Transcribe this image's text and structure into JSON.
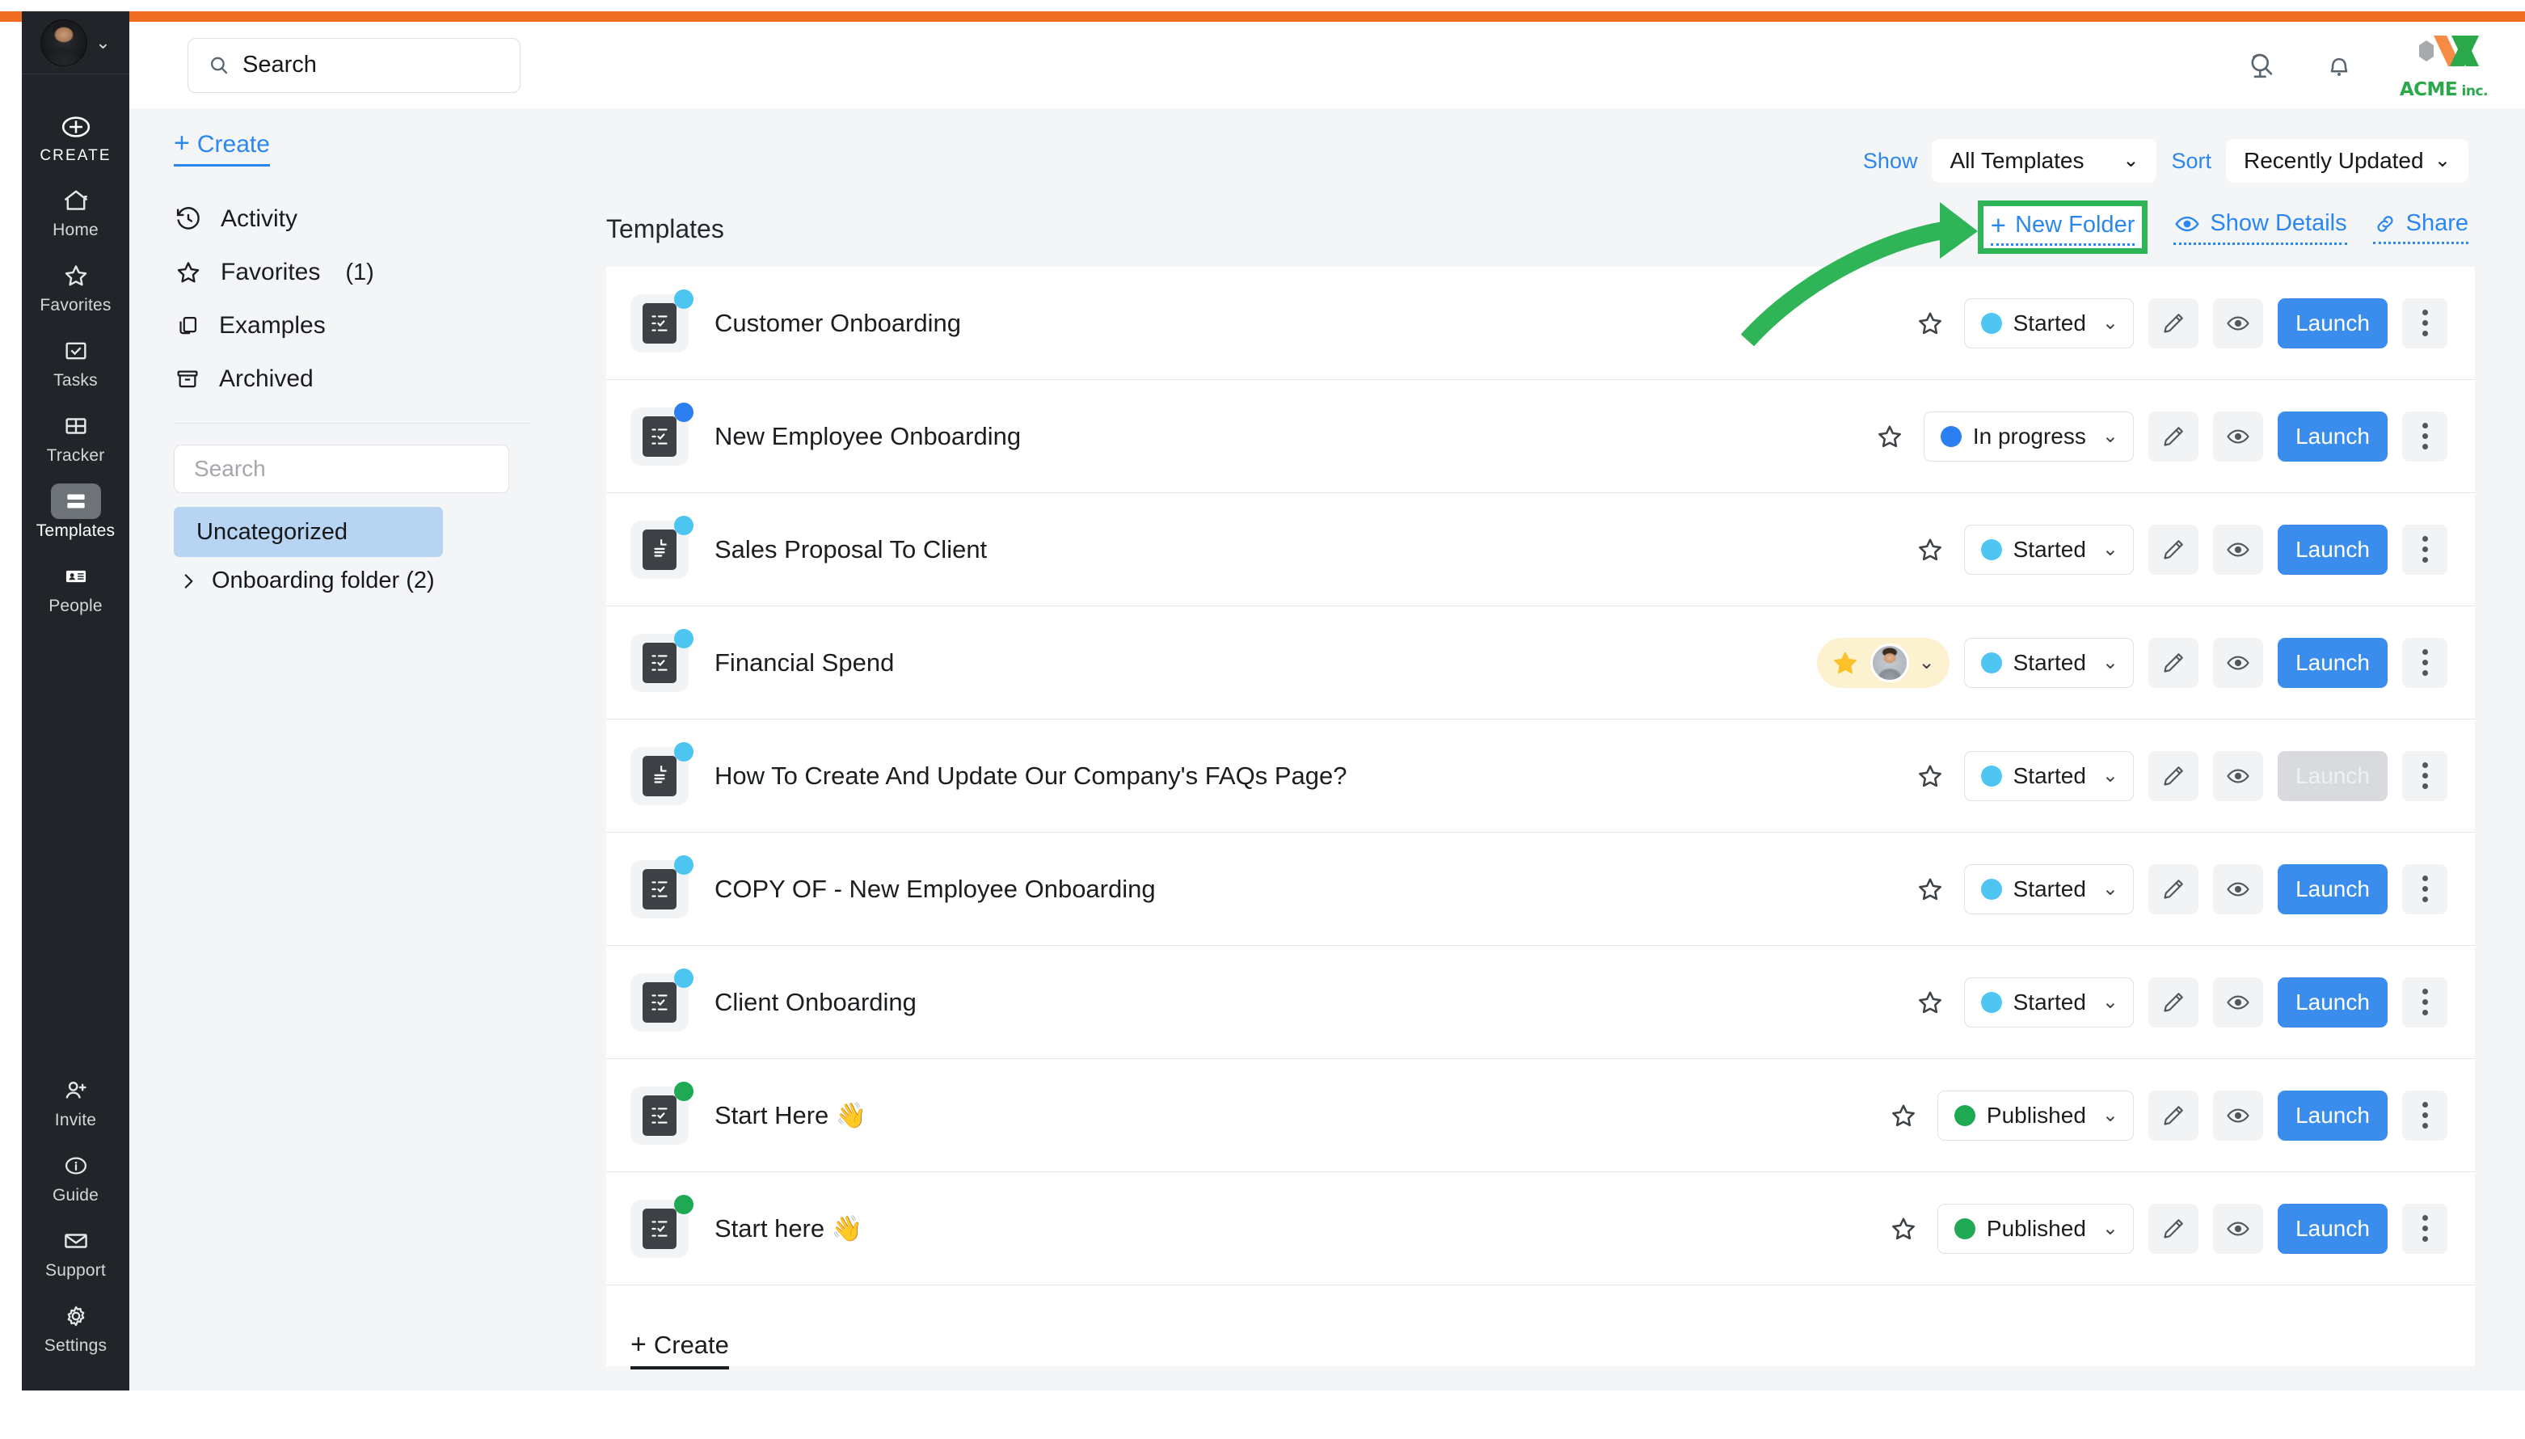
{
  "theme": {
    "accent_orange": "#ef6c23",
    "accent_blue": "#2b87f0",
    "launch_blue": "#3b8ded",
    "highlight_green": "#2fb457",
    "status_started": "#4ec5f1",
    "status_in_progress": "#2b7ff0",
    "status_published": "#1fa952",
    "favorite_yellow": "#fdf2cf",
    "star_gold": "#fcc12a"
  },
  "rail": {
    "profile": {
      "avatar": "user-avatar",
      "chevron": "chevron-down-icon"
    },
    "items": [
      {
        "label": "CREATE",
        "icon": "plus-circle-icon",
        "active": false
      },
      {
        "label": "Home",
        "icon": "home-icon",
        "active": false
      },
      {
        "label": "Favorites",
        "icon": "star-icon",
        "active": false
      },
      {
        "label": "Tasks",
        "icon": "check-square-icon",
        "active": false
      },
      {
        "label": "Tracker",
        "icon": "grid-icon",
        "active": false
      },
      {
        "label": "Templates",
        "icon": "templates-icon",
        "active": true
      },
      {
        "label": "People",
        "icon": "contact-card-icon",
        "active": false
      }
    ],
    "bottom_items": [
      {
        "label": "Invite",
        "icon": "user-plus-icon"
      },
      {
        "label": "Guide",
        "icon": "info-circle-icon"
      },
      {
        "label": "Support",
        "icon": "envelope-icon"
      },
      {
        "label": "Settings",
        "icon": "gear-icon"
      }
    ]
  },
  "header": {
    "search": {
      "placeholder": "Search",
      "value": "Search",
      "icon": "search-icon"
    },
    "globe_icon": "globe-icon",
    "bell_icon": "bell-icon",
    "brand": {
      "name": "ACME",
      "suffix": " inc.",
      "logo": "acme-hexagon-logo"
    }
  },
  "leftnav": {
    "create_label": "Create",
    "create_plus": "+",
    "items": [
      {
        "label": "Activity",
        "icon": "history-icon",
        "count": ""
      },
      {
        "label": "Favorites",
        "icon": "star-icon",
        "count": "(1)"
      },
      {
        "label": "Examples",
        "icon": "copy-icon",
        "count": ""
      },
      {
        "label": "Archived",
        "icon": "archive-icon",
        "count": ""
      }
    ],
    "folder_search_placeholder": "Search",
    "folders": [
      {
        "label": "Uncategorized",
        "selected": true,
        "expandable": false
      },
      {
        "label": "Onboarding folder (2)",
        "selected": false,
        "expandable": true
      }
    ]
  },
  "toolbar": {
    "show_label": "Show",
    "show_value": "All Templates",
    "sort_label": "Sort",
    "sort_value": "Recently Updated",
    "new_folder_label": "New Folder",
    "new_folder_plus": "+",
    "show_details_label": "Show Details",
    "share_label": "Share",
    "eye_icon": "eye-icon",
    "link_icon": "link-icon",
    "highlighted_action": "New Folder"
  },
  "main": {
    "title": "Templates",
    "create_bottom_label": "Create",
    "create_bottom_plus": "+",
    "launch_label": "Launch",
    "rows": [
      {
        "title": "Customer Onboarding",
        "icon": "checklist-tile-icon",
        "badge_color": "#4ec5f1",
        "status": "Started",
        "status_color": "#4ec5f1",
        "favorited": false,
        "launch_enabled": true
      },
      {
        "title": "New Employee Onboarding",
        "icon": "checklist-tile-icon",
        "badge_color": "#2b7ff0",
        "status": "In progress",
        "status_color": "#2b7ff0",
        "favorited": false,
        "launch_enabled": true
      },
      {
        "title": "Sales Proposal To Client",
        "icon": "document-tile-icon",
        "badge_color": "#4ec5f1",
        "status": "Started",
        "status_color": "#4ec5f1",
        "favorited": false,
        "launch_enabled": true
      },
      {
        "title": "Financial Spend",
        "icon": "checklist-tile-icon",
        "badge_color": "#4ec5f1",
        "status": "Started",
        "status_color": "#4ec5f1",
        "favorited": true,
        "launch_enabled": true
      },
      {
        "title": "How To Create And Update Our Company's FAQs Page?",
        "icon": "document-tile-icon",
        "badge_color": "#4ec5f1",
        "status": "Started",
        "status_color": "#4ec5f1",
        "favorited": false,
        "launch_enabled": false
      },
      {
        "title": "COPY OF - New Employee Onboarding",
        "icon": "checklist-tile-icon",
        "badge_color": "#4ec5f1",
        "status": "Started",
        "status_color": "#4ec5f1",
        "favorited": false,
        "launch_enabled": true
      },
      {
        "title": "Client Onboarding",
        "icon": "checklist-tile-icon",
        "badge_color": "#4ec5f1",
        "status": "Started",
        "status_color": "#4ec5f1",
        "favorited": false,
        "launch_enabled": true
      },
      {
        "title": "Start Here 👋",
        "icon": "checklist-tile-icon",
        "badge_color": "#1fa952",
        "status": "Published",
        "status_color": "#1fa952",
        "favorited": false,
        "launch_enabled": true
      },
      {
        "title": "Start here 👋",
        "icon": "checklist-tile-icon",
        "badge_color": "#1fa952",
        "status": "Published",
        "status_color": "#1fa952",
        "favorited": false,
        "launch_enabled": true
      }
    ]
  },
  "annotation": {
    "arrow": "curved-green-arrow",
    "arrow_color": "#2fb457",
    "highlight_box_color": "#2fb457"
  }
}
